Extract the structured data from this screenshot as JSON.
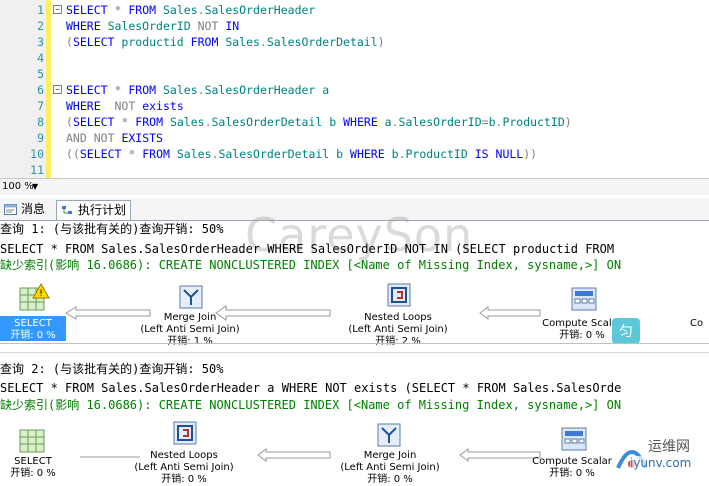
{
  "editor": {
    "lines": [
      {
        "n": "1",
        "code": "SELECT * FROM Sales.SalesOrderHeader"
      },
      {
        "n": "2",
        "code": "WHERE SalesOrderID NOT IN"
      },
      {
        "n": "3",
        "code": "(SELECT productid FROM Sales.SalesOrderDetail)"
      },
      {
        "n": "4",
        "code": ""
      },
      {
        "n": "5",
        "code": ""
      },
      {
        "n": "6",
        "code": "SELECT * FROM Sales.SalesOrderHeader a"
      },
      {
        "n": "7",
        "code": "WHERE  NOT exists"
      },
      {
        "n": "8",
        "code": "(SELECT * FROM Sales.SalesOrderDetail b WHERE a.SalesOrderID=b.ProductID)"
      },
      {
        "n": "9",
        "code": "AND NOT EXISTS"
      },
      {
        "n": "10",
        "code": "((SELECT * FROM Sales.SalesOrderDetail b WHERE b.ProductID IS NULL))"
      },
      {
        "n": "11",
        "code": ""
      }
    ]
  },
  "zoom": {
    "value": "100 %"
  },
  "tabs": [
    {
      "label": "消息",
      "icon": "messages-icon"
    },
    {
      "label": "执行计划",
      "icon": "execution-plan-icon"
    }
  ],
  "watermark": "CareySon",
  "query1": {
    "header": "查询 1: (与该批有关的)查询开销: 50%",
    "sql": "SELECT * FROM Sales.SalesOrderHeader WHERE SalesOrderID NOT IN (SELECT productid FROM",
    "missing": "缺少索引(影响 16.0686): CREATE NONCLUSTERED INDEX [<Name of Missing Index, sysname,>] ON",
    "nodes": [
      {
        "name": "SELECT",
        "cost": "开销: 0 %",
        "icon": "select-warning-icon"
      },
      {
        "name": "Merge Join",
        "sub": "(Left Anti Semi Join)",
        "cost": "开销: 1 %",
        "icon": "merge-join-icon"
      },
      {
        "name": "Nested Loops",
        "sub": "(Left Anti Semi Join)",
        "cost": "开销: 2 %",
        "icon": "nested-loops-icon"
      },
      {
        "name": "Compute Scalar",
        "cost": "开销: 0 %",
        "icon": "compute-scalar-icon"
      },
      {
        "name": "Co",
        "icon": ""
      }
    ]
  },
  "query2": {
    "header": "查询 2: (与该批有关的)查询开销: 50%",
    "sql": "SELECT * FROM Sales.SalesOrderHeader a WHERE NOT exists (SELECT * FROM Sales.SalesOrde",
    "missing": "缺少索引(影响 16.0686): CREATE NONCLUSTERED INDEX [<Name of Missing Index, sysname,>] ON",
    "nodes": [
      {
        "name": "SELECT",
        "cost": "开销: 0 %",
        "icon": "select-icon"
      },
      {
        "name": "Nested Loops",
        "sub": "(Left Anti Semi Join)",
        "cost": "开销: 0 %",
        "icon": "nested-loops-icon"
      },
      {
        "name": "Merge Join",
        "sub": "(Left Anti Semi Join)",
        "cost": "开销: 0 %",
        "icon": "merge-join-icon"
      },
      {
        "name": "Compute Scalar",
        "cost": "开销: 0 %",
        "icon": "compute-scalar-icon"
      }
    ]
  },
  "site_logo": {
    "text": "运维网",
    "url_text": "iyunv.com"
  }
}
